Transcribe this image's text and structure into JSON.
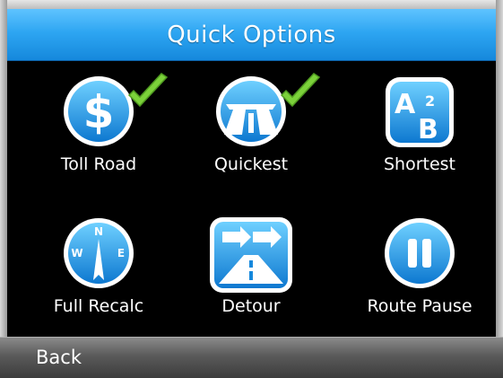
{
  "header": {
    "title": "Quick Options"
  },
  "options": [
    {
      "label": "Toll Road",
      "icon": "dollar-icon",
      "checked": true
    },
    {
      "label": "Quickest",
      "icon": "highway-icon",
      "checked": true
    },
    {
      "label": "Shortest",
      "icon": "a-to-b-icon",
      "checked": false
    },
    {
      "label": "Full Recalc",
      "icon": "compass-icon",
      "checked": false
    },
    {
      "label": "Detour",
      "icon": "detour-icon",
      "checked": false
    },
    {
      "label": "Route Pause",
      "icon": "pause-icon",
      "checked": false
    }
  ],
  "footer": {
    "back_label": "Back"
  },
  "colors": {
    "accent": "#1b8fe0",
    "check": "#7bd13a"
  }
}
